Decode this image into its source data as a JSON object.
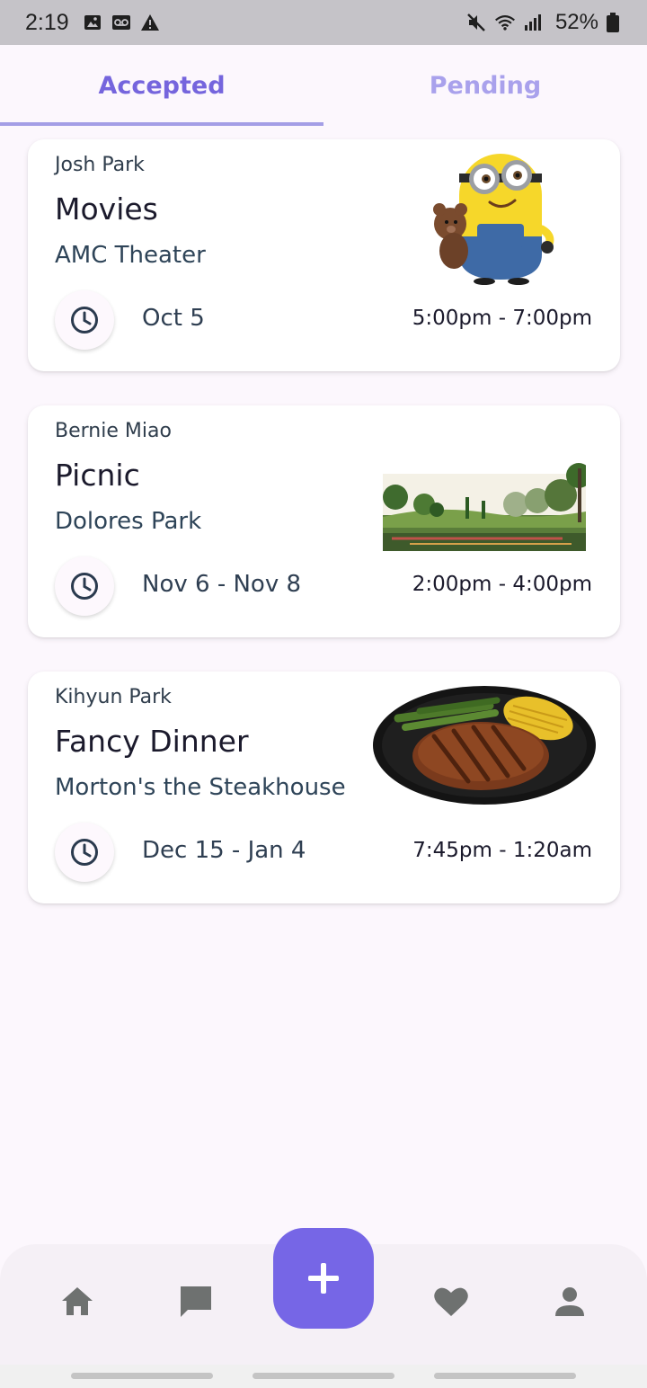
{
  "status_bar": {
    "time": "2:19",
    "battery_percent": "52%",
    "icons": [
      "image-icon",
      "voicemail-icon",
      "warning-icon",
      "mute-icon",
      "wifi-icon",
      "signal-icon",
      "battery-icon"
    ]
  },
  "tabs": [
    {
      "label": "Accepted",
      "selected": true
    },
    {
      "label": "Pending",
      "selected": false
    }
  ],
  "events": [
    {
      "host": "Josh Park",
      "title": "Movies",
      "location": "AMC Theater",
      "date": "Oct 5",
      "time": "5:00pm - 7:00pm",
      "image": "minion-with-teddy-bear"
    },
    {
      "host": "Bernie Miao",
      "title": "Picnic",
      "location": "Dolores Park",
      "date": "Nov 6 - Nov 8",
      "time": "2:00pm - 4:00pm",
      "image": "park-landscape"
    },
    {
      "host": "Kihyun Park",
      "title": "Fancy Dinner",
      "location": "Morton's the Steakhouse",
      "date": "Dec 15 - Jan 4",
      "time": "7:45pm - 1:20am",
      "image": "steak-dinner-plate"
    }
  ],
  "bottom_nav": {
    "items": [
      "home-icon",
      "chat-icon",
      "add-icon",
      "heart-icon",
      "person-icon"
    ]
  },
  "colors": {
    "accent": "#7666e6",
    "tab_selected": "#7565dd",
    "tab_unselected": "#a9a1ec",
    "background": "#fcf7fd"
  }
}
